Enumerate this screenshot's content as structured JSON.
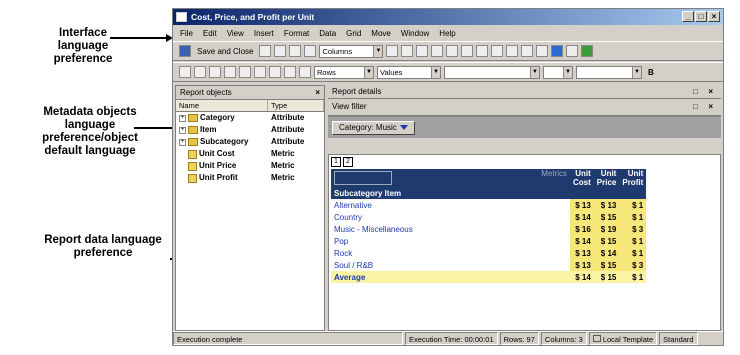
{
  "callouts": {
    "interface_lang": "Interface\nlanguage\npreference",
    "metadata_lang": "Metadata objects\nlanguage\npreference/object\ndefault language",
    "report_lang": "Report data language\npreference"
  },
  "window": {
    "title": "Cost, Price, and Profit per Unit",
    "controls": [
      "_",
      "□",
      "×"
    ]
  },
  "menu": [
    "File",
    "Edit",
    "View",
    "Insert",
    "Format",
    "Data",
    "Grid",
    "Move",
    "Window",
    "Help"
  ],
  "toolbar1": {
    "save_label": "Save and Close",
    "combo_columns": "Columns"
  },
  "toolbar2": {
    "combo_rows": "Rows",
    "combo_values": "Values",
    "bold": "B"
  },
  "left_panel": {
    "title": "Report objects",
    "close": "×",
    "col_name": "Name",
    "col_type": "Type",
    "objects": [
      {
        "name": "Category",
        "type": "Attribute",
        "expandable": true
      },
      {
        "name": "Item",
        "type": "Attribute",
        "expandable": true
      },
      {
        "name": "Subcategory",
        "type": "Attribute",
        "expandable": true
      },
      {
        "name": "Unit Cost",
        "type": "Metric",
        "expandable": false
      },
      {
        "name": "Unit Price",
        "type": "Metric",
        "expandable": false
      },
      {
        "name": "Unit Profit",
        "type": "Metric",
        "expandable": false
      }
    ]
  },
  "right_panel": {
    "details_title": "Report details",
    "filter_title": "View filter",
    "controls": "□ ×",
    "page_by_button": "Category: Music",
    "pages": [
      "1",
      "2"
    ]
  },
  "report": {
    "metrics_label": "Metrics",
    "col_headers": [
      [
        "Unit",
        "Cost"
      ],
      [
        "Unit",
        "Price"
      ],
      [
        "Unit",
        "Profit"
      ]
    ],
    "row_header": "Subcategory  Item",
    "rows": [
      {
        "label": "Alternative",
        "vals": [
          "$ 13",
          "$ 13",
          "$ 1"
        ]
      },
      {
        "label": "Country",
        "vals": [
          "$ 14",
          "$ 15",
          "$ 1"
        ]
      },
      {
        "label": "Music - Miscellaneous",
        "vals": [
          "$ 16",
          "$ 19",
          "$ 3"
        ]
      },
      {
        "label": "Pop",
        "vals": [
          "$ 14",
          "$ 15",
          "$ 1"
        ]
      },
      {
        "label": "Rock",
        "vals": [
          "$ 13",
          "$ 14",
          "$ 1"
        ]
      },
      {
        "label": "Soul / R&B",
        "vals": [
          "$ 13",
          "$ 15",
          "$ 3"
        ]
      }
    ],
    "average": {
      "label": "Average",
      "vals": [
        "$ 14",
        "$ 15",
        "$ 1"
      ]
    }
  },
  "status": {
    "left": "Execution complete",
    "exec_time": "Execution Time: 00:00:01",
    "rows": "Rows: 97",
    "columns": "Columns: 3",
    "template": "Local Template",
    "mode": "Standard"
  }
}
